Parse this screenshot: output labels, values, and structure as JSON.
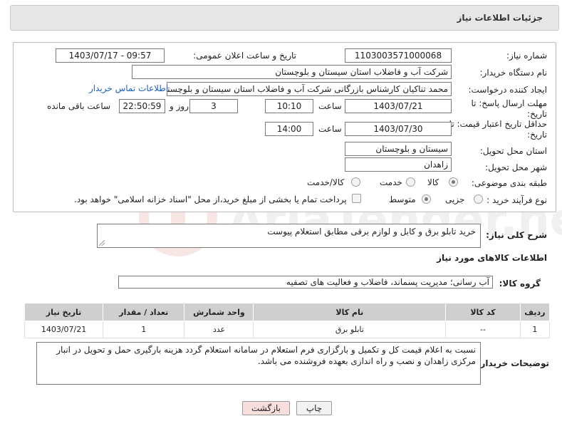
{
  "header": {
    "title": "جزئیات اطلاعات نیاز"
  },
  "form": {
    "need_number_label": "شماره نیاز:",
    "need_number": "1103003571000068",
    "announce_label": "تاریخ و ساعت اعلان عمومی:",
    "announce_value": "1403/07/17 - 09:57",
    "buyer_org_label": "نام دستگاه خریدار:",
    "buyer_org": "شرکت آب و فاضلاب استان سیستان و بلوچستان",
    "creator_label": "ایجاد کننده درخواست:",
    "creator": "محمد تناکیان کارشناس بازرگانی شرکت آب و فاضلاب استان سیستان و بلوچستان",
    "buyer_contact_link": "اطلاعات تماس خریدار",
    "reply_deadline_label": "مهلت ارسال پاسخ: تا تاریخ:",
    "reply_date": "1403/07/21",
    "time_label": "ساعت",
    "reply_time": "10:10",
    "days_value": "3",
    "days_label": "روز و",
    "remaining_time": "22:50:59",
    "remaining_label": "ساعت باقی مانده",
    "price_validity_label": "حداقل تاریخ اعتبار قیمت: تا تاریخ:",
    "validity_date": "1403/07/30",
    "validity_time_label": "ساعت",
    "validity_time": "14:00",
    "province_label": "استان محل تحویل:",
    "province": "سیستان و بلوچستان",
    "city_label": "شهر محل تحویل:",
    "city": "زاهدان",
    "category_label": "طبقه بندی موضوعی:",
    "category_options": [
      "کالا",
      "خدمت",
      "کالا/خدمت"
    ],
    "category_selected": "کالا",
    "process_label": "نوع فرآیند خرید :",
    "process_options": [
      "جزیی",
      "متوسط"
    ],
    "process_selected": "جزیی",
    "payment_note": "پرداخت تمام یا بخشی از مبلغ خرید،از محل \"اسناد خزانه اسلامی\" خواهد بود."
  },
  "summary": {
    "label": "شرح کلی نیاز:",
    "text": "خرید تابلو برق و کابل و لوازم برقی مطابق استعلام پیوست"
  },
  "goods_info": {
    "title": "اطلاعات کالاهای مورد نیاز",
    "group_label": "گروه کالا:",
    "group_value": "آب رسانی؛ مدیریت پسماند، فاضلاب و فعالیت های تصفیه",
    "columns": [
      "ردیف",
      "کد کالا",
      "نام کالا",
      "واحد شمارش",
      "تعداد / مقدار",
      "تاریخ نیاز"
    ],
    "rows": [
      [
        "1",
        "--",
        "تابلو برق",
        "عدد",
        "1",
        "1403/07/21"
      ]
    ]
  },
  "buyer_notes": {
    "label": "توضیحات خریدار:",
    "text": "نسبت به اعلام قیمت کل و تکمیل و بارگزاری فرم استعلام در سامانه استعلام گردد هزینه بارگیری حمل و تحویل در انبار مرکزی زاهدان و نصب و راه اندازی  بعهده فروشنده می باشد."
  },
  "buttons": {
    "print": "چاپ",
    "back": "بازگشت"
  },
  "colors": {
    "header_bg": "#e7e7e7",
    "link": "#1f5fbf",
    "back_button_bg": "#f9dede",
    "table_header": "#cfcfcf"
  }
}
